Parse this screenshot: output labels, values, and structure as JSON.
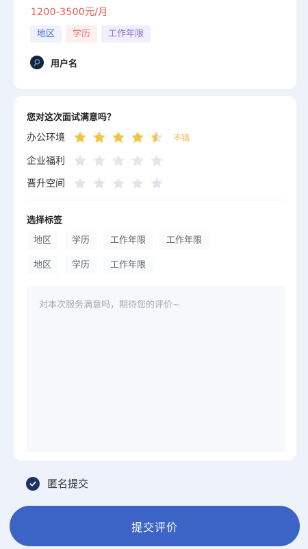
{
  "job": {
    "salary": "1200-3500元/月",
    "tags": [
      "地区",
      "学历",
      "工作年限"
    ],
    "user_name": "用户名"
  },
  "rating": {
    "question": "您对这次面试满意吗？",
    "items": [
      {
        "label": "办公环境",
        "value": 4.5,
        "max": 5,
        "text": "不错"
      },
      {
        "label": "企业福利",
        "value": 0,
        "max": 5,
        "text": ""
      },
      {
        "label": "晋升空间",
        "value": 0,
        "max": 5,
        "text": ""
      }
    ],
    "star_color": "#f4c340",
    "star_empty_color": "#e3e5ea"
  },
  "tags_section": {
    "title": "选择标签",
    "rows": [
      [
        "地区",
        "学历",
        "工作年限",
        "工作年限"
      ],
      [
        "地区",
        "学历",
        "工作年限"
      ]
    ]
  },
  "comment": {
    "placeholder": "对本次服务满意吗，期待您的评价~",
    "value": ""
  },
  "anonymous": {
    "label": "匿名提交",
    "checked": true
  },
  "submit": {
    "label": "提交评价",
    "color": "#3b64c6"
  }
}
